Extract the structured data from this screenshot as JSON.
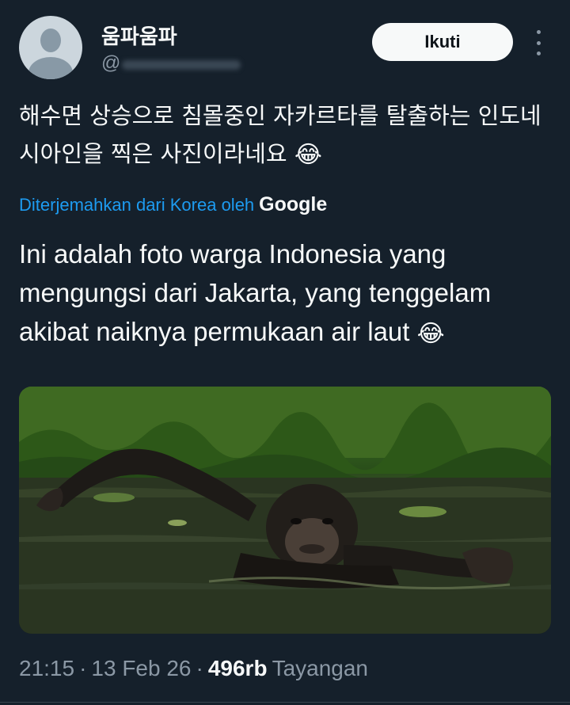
{
  "author": {
    "display_name": "움파움파",
    "handle": "@"
  },
  "buttons": {
    "follow_label": "Ikuti"
  },
  "tweet": {
    "original_text": "해수면 상승으로 침몰중인 자카르타를 탈출하는 인도네시아인을 찍은 사진이라네요",
    "translation_notice": "Diterjemahkan dari Korea oleh",
    "translation_provider": "Google",
    "translated_text": "Ini adalah foto warga Indonesia yang mengungsi dari Jakarta, yang tenggelam akibat naiknya permukaan air laut",
    "emoji": "😂",
    "time": "21:15",
    "date": "13 Feb 26",
    "views": "496rb",
    "views_label": "Tayangan"
  },
  "icons": {
    "more": "more-vertical-icon",
    "avatar": "default-avatar-icon"
  },
  "colors": {
    "background": "#15202b",
    "link": "#1d9bf0",
    "muted": "#8b98a5"
  }
}
